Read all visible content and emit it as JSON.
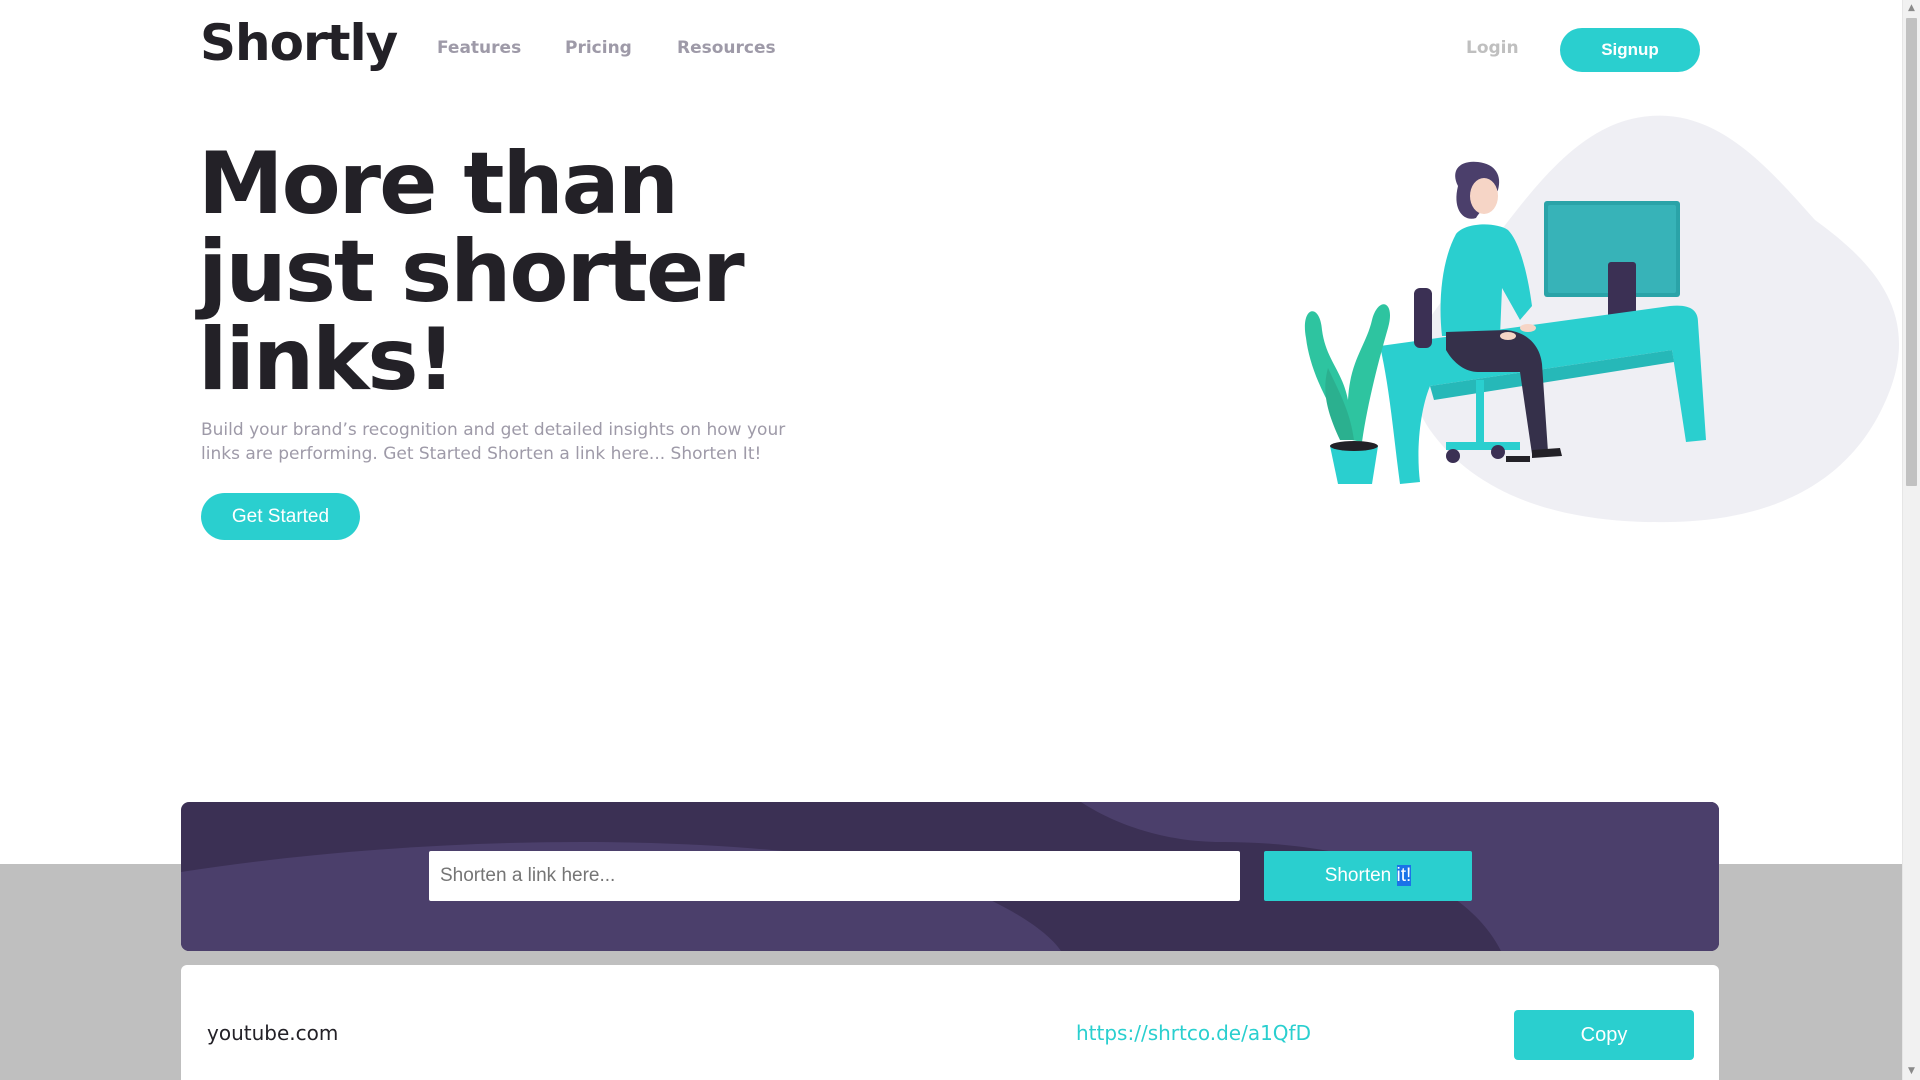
{
  "header": {
    "logo": "Shortly",
    "nav": [
      "Features",
      "Pricing",
      "Resources"
    ],
    "login": "Login",
    "signup": "Signup"
  },
  "hero": {
    "title_lines": [
      "More than",
      "just shorter",
      "links!"
    ],
    "subtitle": "Build your brand’s recognition and get detailed insights on how your links are performing. Get Started Shorten a link here... Shorten It!",
    "cta": "Get Started"
  },
  "shorten": {
    "placeholder": "Shorten a link here...",
    "button_main": "Shorten ",
    "button_selected": "it!"
  },
  "result": {
    "original": "youtube.com",
    "short": "https://shrtco.de/a1QfD",
    "copy": "Copy"
  },
  "colors": {
    "accent": "#2acfcf",
    "dark_violet": "#3b3054",
    "very_dark": "#232127",
    "gray_text": "#9e9aa8",
    "band_gray": "#bfbfbf"
  }
}
